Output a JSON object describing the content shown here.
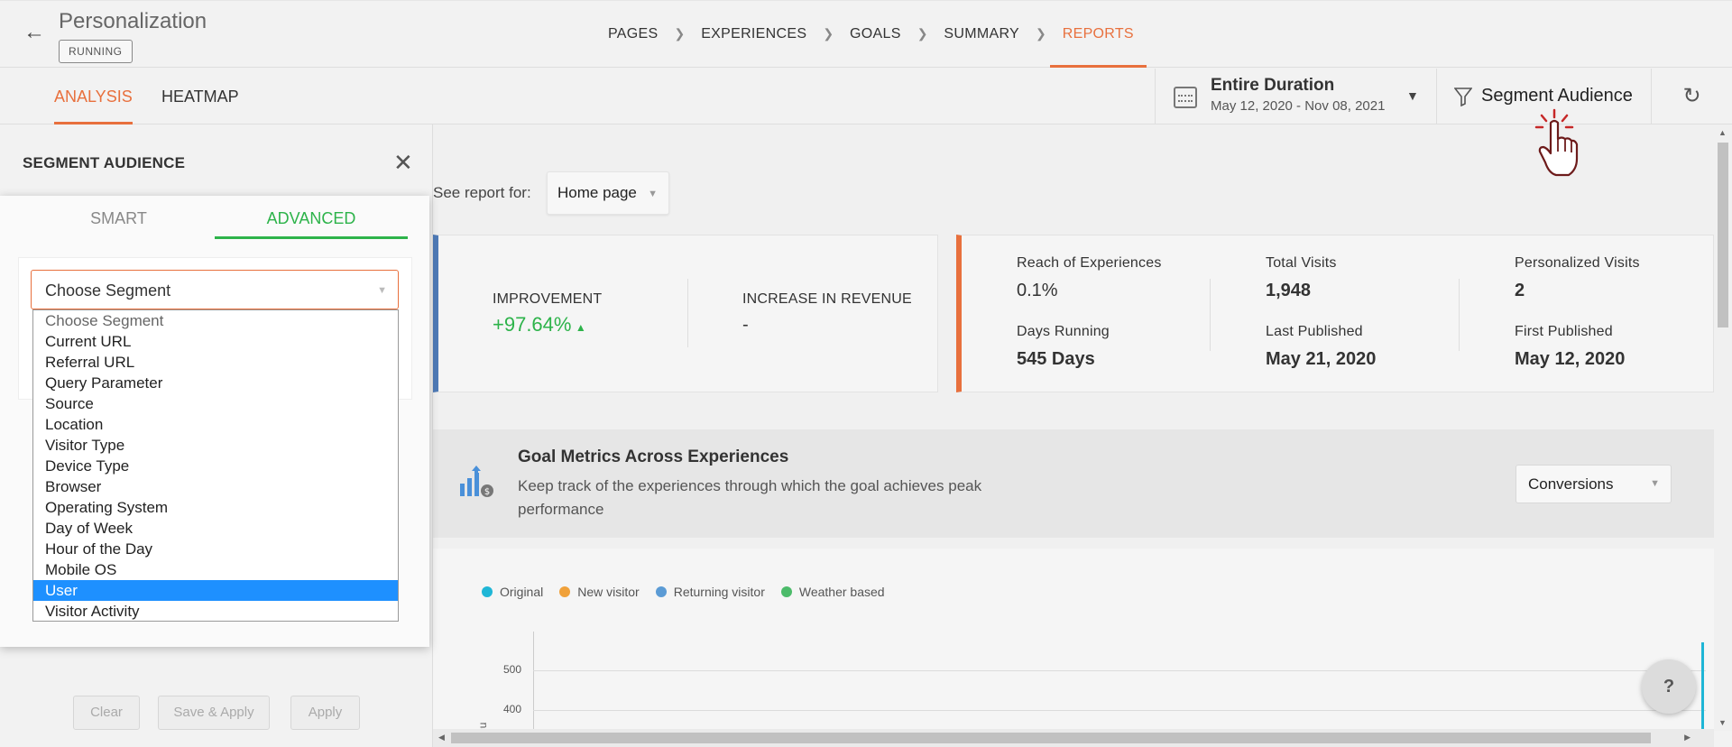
{
  "header": {
    "title": "Personalization",
    "status": "RUNNING",
    "steps": [
      "PAGES",
      "EXPERIENCES",
      "GOALS",
      "SUMMARY",
      "REPORTS"
    ]
  },
  "subnav": {
    "tabs": [
      "ANALYSIS",
      "HEATMAP"
    ],
    "date_title": "Entire Duration",
    "date_range": "May 12, 2020 - Nov 08, 2021",
    "segment_label": "Segment Audience"
  },
  "report": {
    "see_label": "See report for:",
    "page_value": "Home page"
  },
  "summary": {
    "improvement_label": "IMPROVEMENT",
    "improvement_value": "+97.64%",
    "revenue_label": "INCREASE IN REVENUE",
    "revenue_value": "-",
    "reach_label": "Reach of Experiences",
    "reach_value": "0.1%",
    "visits_label": "Total Visits",
    "visits_value": "1,948",
    "pvisits_label": "Personalized Visits",
    "pvisits_value": "2",
    "days_label": "Days Running",
    "days_value": "545 Days",
    "lastpub_label": "Last Published",
    "lastpub_value": "May 21, 2020",
    "firstpub_label": "First Published",
    "firstpub_value": "May 12, 2020"
  },
  "goal": {
    "title": "Goal Metrics Across Experiences",
    "desc": "Keep track of the experiences through which the goal achieves peak performance",
    "metric": "Conversions"
  },
  "chart": {
    "legend": [
      {
        "name": "Original",
        "color": "#1fb6d6"
      },
      {
        "name": "New visitor",
        "color": "#f0a13a"
      },
      {
        "name": "Returning visitor",
        "color": "#5b9bd5"
      },
      {
        "name": "Weather based",
        "color": "#4cbb6a"
      }
    ],
    "ticks": [
      "500",
      "400"
    ],
    "ylabel_fragment": "ns"
  },
  "panel": {
    "title": "SEGMENT AUDIENCE",
    "tabs": [
      "SMART",
      "ADVANCED"
    ],
    "select_value": "Choose Segment",
    "options": [
      "Choose Segment",
      "Current URL",
      "Referral URL",
      "Query Parameter",
      "Source",
      "Location",
      "Visitor Type",
      "Device Type",
      "Browser",
      "Operating System",
      "Day of Week",
      "Hour of the Day",
      "Mobile OS",
      "User",
      "Visitor Activity"
    ],
    "buttons": [
      "Clear",
      "Save & Apply",
      "Apply"
    ]
  },
  "help": "?"
}
